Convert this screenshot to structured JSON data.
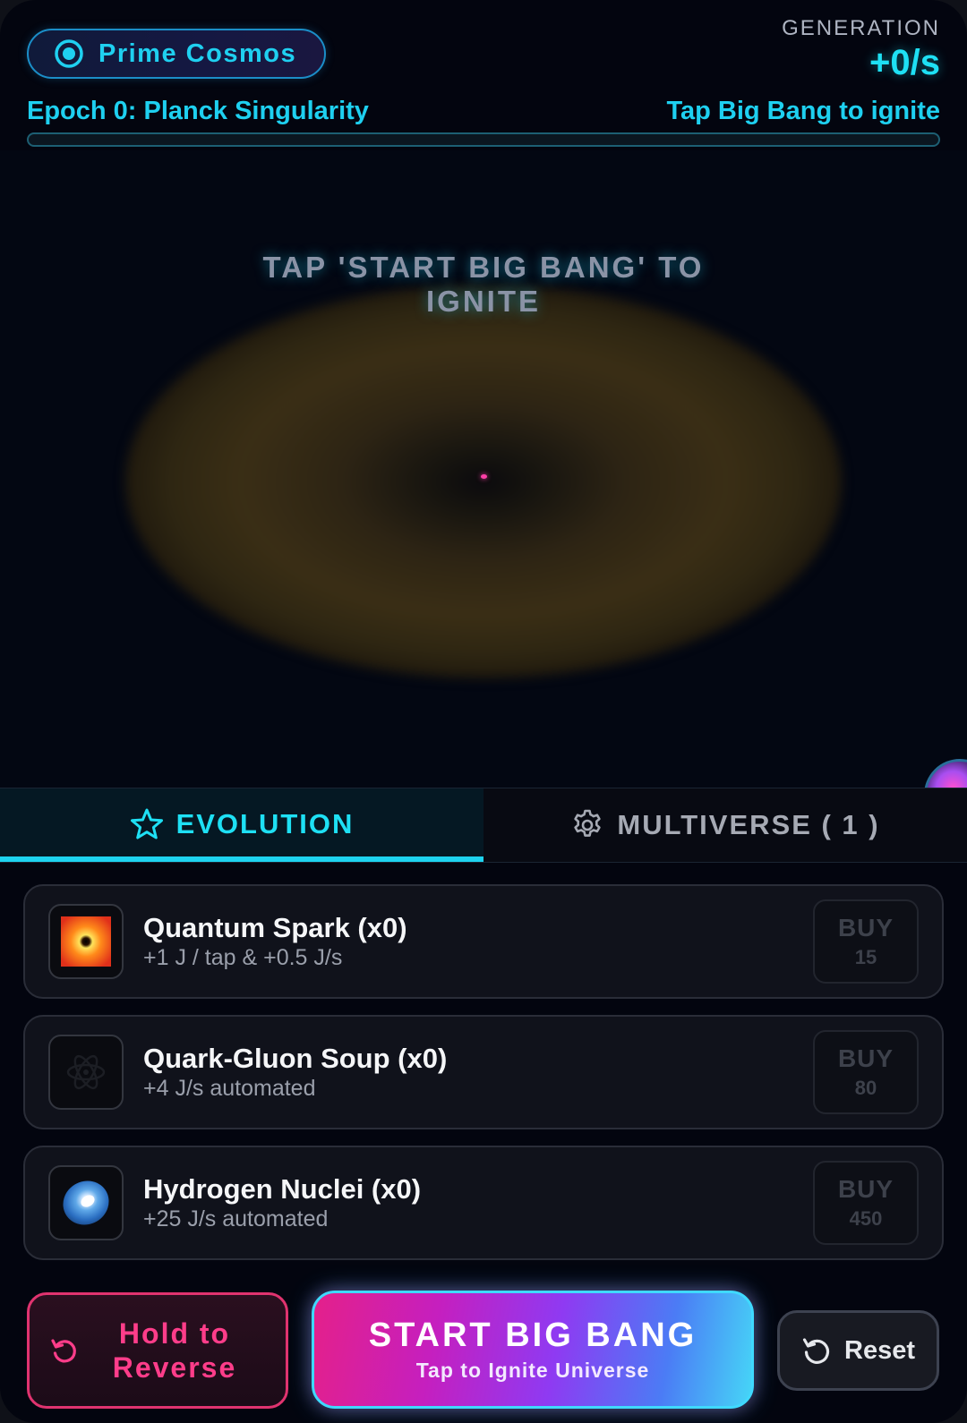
{
  "header": {
    "universe_name": "Prime Cosmos",
    "generation_label": "GENERATION",
    "generation_rate": "+0/s",
    "epoch_title": "Epoch 0: Planck Singularity",
    "epoch_hint": "Tap Big Bang to ignite",
    "epoch_progress": 0
  },
  "canvas": {
    "prompt": "TAP 'START BIG BANG' TO IGNITE"
  },
  "tabs": [
    {
      "label": "EVOLUTION",
      "icon": "star-icon",
      "active": true
    },
    {
      "label": "MULTIVERSE ( 1 )",
      "icon": "gear-icon",
      "active": false
    }
  ],
  "upgrades": [
    {
      "name": "Quantum Spark (x0)",
      "description": "+1 J / tap & +0.5 J/s",
      "buy_label": "BUY",
      "cost": "15",
      "icon": "quantum-spark-icon"
    },
    {
      "name": "Quark-Gluon Soup (x0)",
      "description": "+4 J/s automated",
      "buy_label": "BUY",
      "cost": "80",
      "icon": "atom-icon"
    },
    {
      "name": "Hydrogen Nuclei (x0)",
      "description": "+25 J/s automated",
      "buy_label": "BUY",
      "cost": "450",
      "icon": "hydrogen-nuclei-icon"
    }
  ],
  "controls": {
    "reverse_label": "Hold to Reverse",
    "bigbang_title": "START BIG BANG",
    "bigbang_subtitle": "Tap to Ignite Universe",
    "reset_label": "Reset"
  },
  "colors": {
    "accent_cyan": "#1ee0f4",
    "accent_pink": "#ff3d8a",
    "background": "#03050f"
  }
}
